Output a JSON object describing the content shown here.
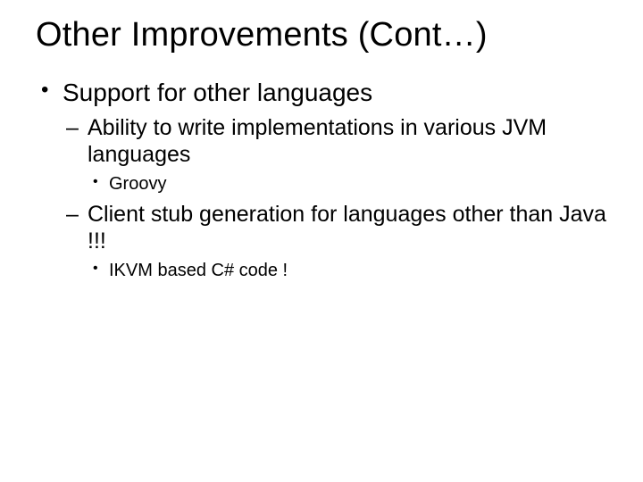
{
  "title": "Other Improvements (Cont…)",
  "bullets": {
    "b1": "Support for other languages",
    "b1_1": "Ability to write implementations in various JVM languages",
    "b1_1_1": "Groovy",
    "b1_2": "Client stub generation for languages other than Java !!!",
    "b1_2_1": "IKVM based C# code !"
  }
}
